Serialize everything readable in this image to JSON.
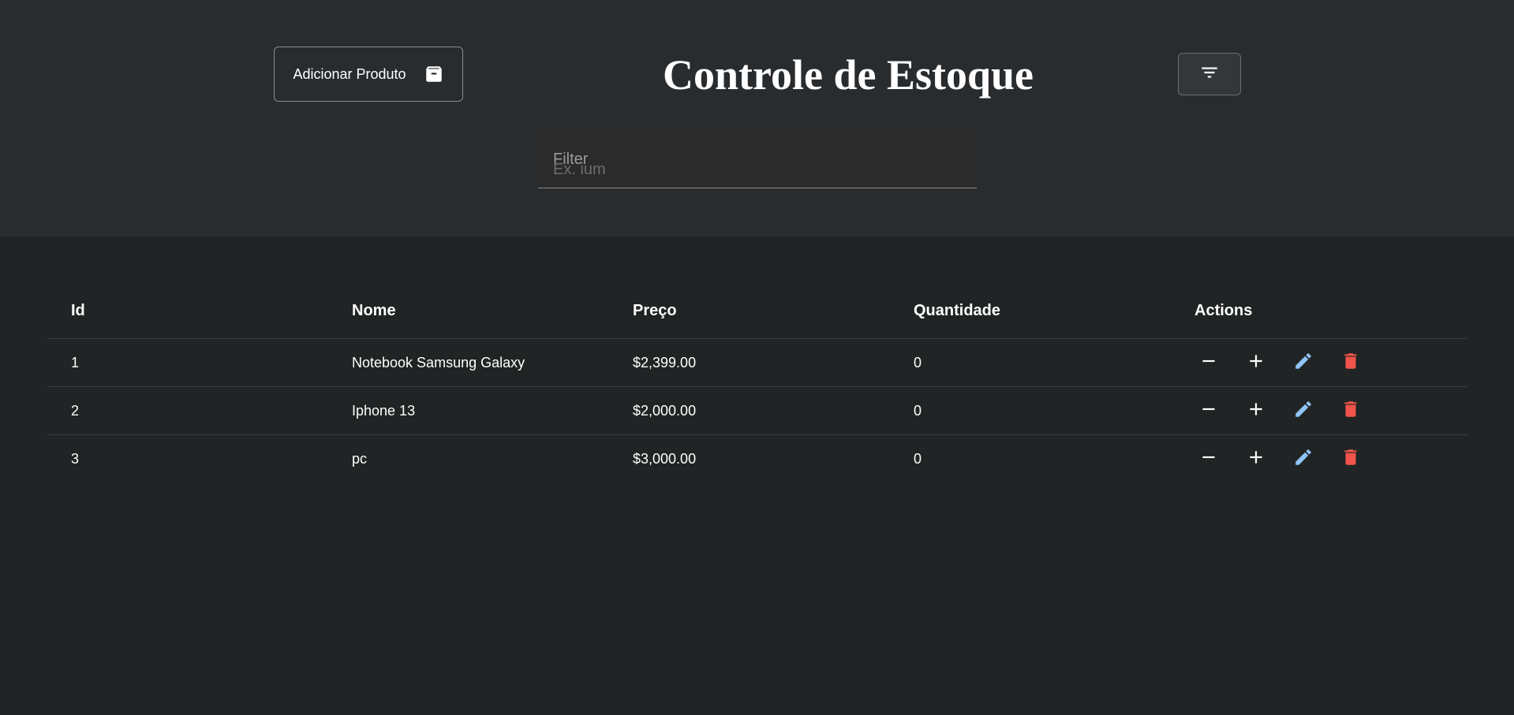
{
  "header": {
    "add_product_label": "Adicionar Produto",
    "title": "Controle de Estoque",
    "filter_field": {
      "label": "Filter",
      "placeholder": "Ex. ium"
    }
  },
  "table": {
    "columns": [
      "Id",
      "Nome",
      "Preço",
      "Quantidade",
      "Actions"
    ],
    "rows": [
      {
        "id": "1",
        "nome": "Notebook Samsung Galaxy",
        "preco": "$2,399.00",
        "quantidade": "0"
      },
      {
        "id": "2",
        "nome": "Iphone 13",
        "preco": "$2,000.00",
        "quantidade": "0"
      },
      {
        "id": "3",
        "nome": "pc",
        "preco": "$3,000.00",
        "quantidade": "0"
      }
    ],
    "action_icons": [
      "minus-icon",
      "plus-icon",
      "pencil-icon",
      "trash-icon"
    ]
  },
  "colors": {
    "header_bg": "#292c2f",
    "body_bg": "#212425",
    "edit_icon": "#90c4f9",
    "delete_icon": "#f0544a"
  }
}
